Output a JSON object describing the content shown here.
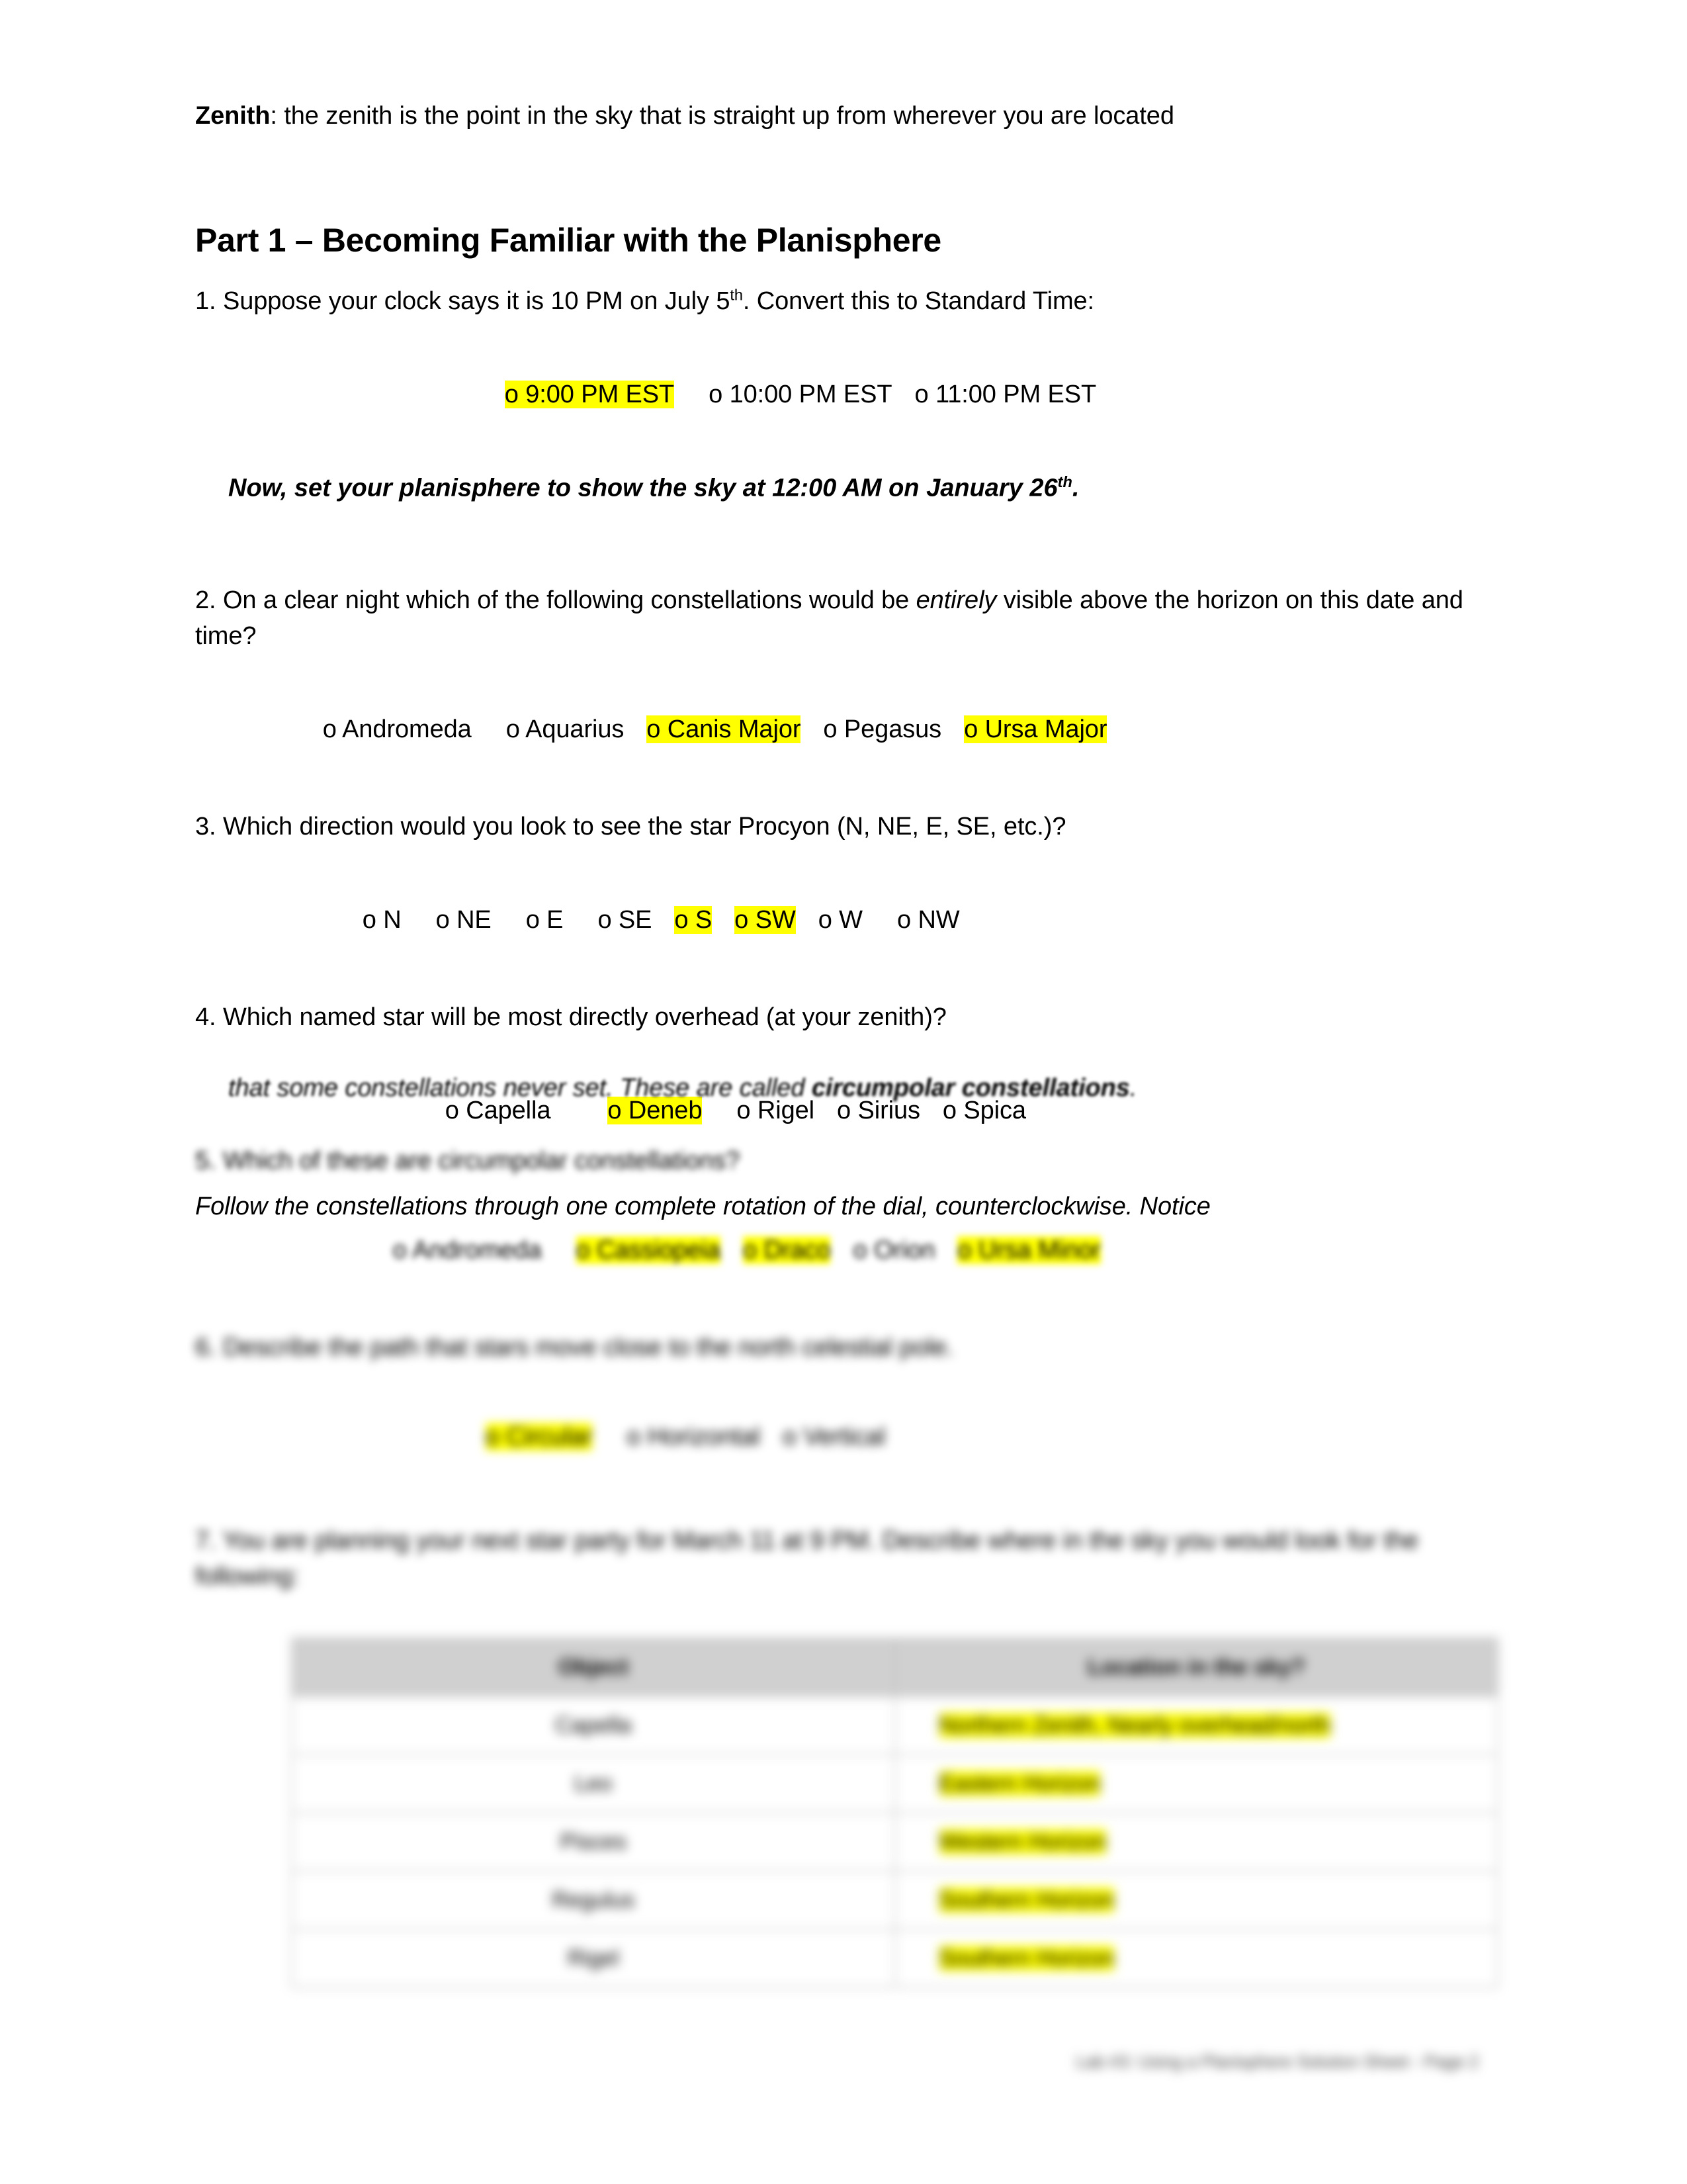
{
  "document": {
    "definition": {
      "term": "Zenith",
      "separator": ": ",
      "text": "the zenith is the point in the sky that is straight up from wherever you are located"
    },
    "part_heading": "Part 1 – Becoming Familiar with the Planisphere",
    "questions": [
      {
        "number": "1.",
        "text_before": " Suppose your clock says it is 10 PM on July 5",
        "superscript": "th",
        "text_after": ".  Convert this to Standard Time:",
        "options": [
          {
            "label": "o 9:00 PM EST",
            "highlighted": true
          },
          {
            "label": "o 10:00 PM EST",
            "highlighted": false
          },
          {
            "label": "o 11:00 PM EST",
            "highlighted": false
          }
        ]
      },
      {
        "number": "2.",
        "text_part1": "  On a clear night which of the following constellations would be ",
        "emphasis": "entirely",
        "text_part2": " visible above the horizon on this date and time?",
        "options": [
          {
            "label": "o Andromeda",
            "highlighted": false
          },
          {
            "label": "o Aquarius",
            "highlighted": false
          },
          {
            "label": "o Canis Major",
            "highlighted": true
          },
          {
            "label": "o Pegasus",
            "highlighted": false
          },
          {
            "label": "o Ursa Major",
            "highlighted": true
          }
        ]
      },
      {
        "number": "3.",
        "text": "  Which direction would you look to see the star Procyon (N, NE, E, SE, etc.)?",
        "options": [
          {
            "label": "o N",
            "highlighted": false
          },
          {
            "label": "o NE",
            "highlighted": false
          },
          {
            "label": "o E",
            "highlighted": false
          },
          {
            "label": "o SE",
            "highlighted": false
          },
          {
            "label": "o S",
            "highlighted": true
          },
          {
            "label": "o SW",
            "highlighted": true
          },
          {
            "label": "o W",
            "highlighted": false
          },
          {
            "label": "o NW",
            "highlighted": false
          }
        ]
      },
      {
        "number": "4.",
        "text": "  Which named star will be most directly overhead (at your zenith)?",
        "options": [
          {
            "label": "o Capella",
            "highlighted": false
          },
          {
            "label": "o Deneb",
            "highlighted": true
          },
          {
            "label": "o Rigel",
            "highlighted": false
          },
          {
            "label": "o Sirius",
            "highlighted": false
          },
          {
            "label": "o Spica",
            "highlighted": false
          }
        ]
      },
      {
        "number": "5.",
        "text": "  Which of these are circumpolar constellations?",
        "options": [
          {
            "label": "o Andromeda",
            "highlighted": false
          },
          {
            "label": "o Cassiopeia",
            "highlighted": true
          },
          {
            "label": "o Draco",
            "highlighted": true
          },
          {
            "label": "o Orion",
            "highlighted": false
          },
          {
            "label": "o Ursa Minor",
            "highlighted": true
          }
        ]
      },
      {
        "number": "6.",
        "text": "  Describe the path that stars move close to the north celestial pole.",
        "options": [
          {
            "label": "o Circular",
            "highlighted": true
          },
          {
            "label": "o Horizontal",
            "highlighted": false
          },
          {
            "label": "o Vertical",
            "highlighted": false
          }
        ]
      },
      {
        "number": "7.",
        "text": "  You are planning your next star party for March 11 at 9 PM.  Describe where in the sky you would look for the following:",
        "options": []
      }
    ],
    "set_planisphere_note": {
      "text_before": "Now, set your planisphere to show the sky at 12:00 AM on January 26",
      "superscript": "th",
      "text_after": "."
    },
    "circumpolar_paragraph": {
      "line1": "Follow the constellations through one complete rotation of the dial, counterclockwise.  Notice",
      "line2_before": "that some constellations never set.  These are called ",
      "line2_bold": "circumpolar constellations",
      "line2_after": "."
    },
    "sky_table": {
      "headers": [
        "Object",
        "Location in the sky?"
      ],
      "rows": [
        {
          "object": "Capella",
          "location": "Northern Zenith, Nearly overhead/north",
          "highlighted": true
        },
        {
          "object": "Leo",
          "location": "Eastern Horizon",
          "highlighted": true
        },
        {
          "object": "Pisces",
          "location": "Western Horizon",
          "highlighted": true
        },
        {
          "object": "Regulus",
          "location": "Southern Horizon",
          "highlighted": true
        },
        {
          "object": "Rigel",
          "location": "Southern Horizon",
          "highlighted": true
        }
      ]
    },
    "footer": "Lab #3: Using a Planisphere Solution Sheet - Page 2"
  }
}
